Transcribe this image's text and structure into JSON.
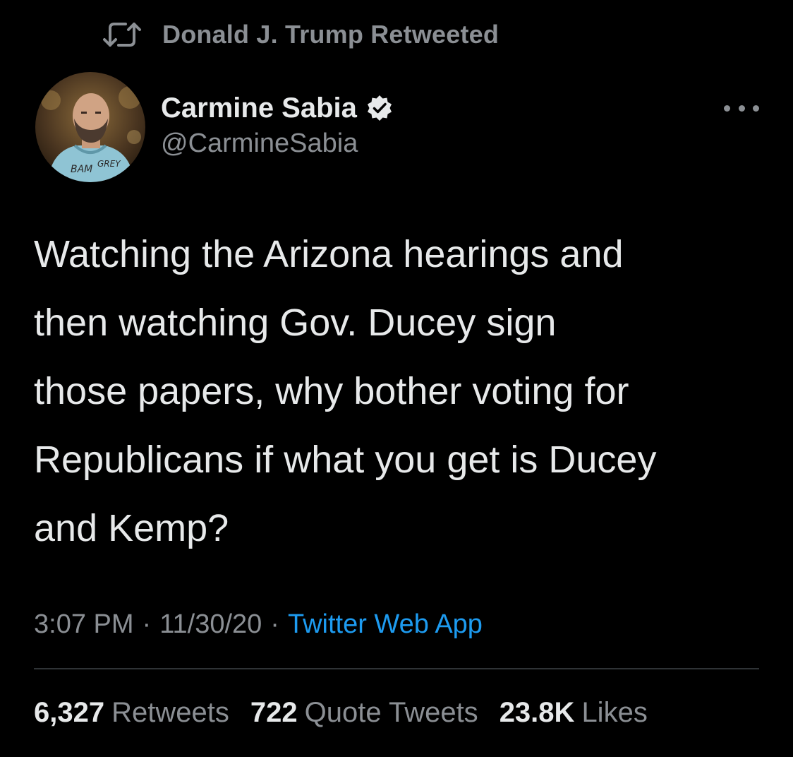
{
  "context": {
    "retweet_label": "Donald J. Trump Retweeted",
    "retweet_icon": "retweet-icon"
  },
  "author": {
    "name": "Carmine Sabia",
    "handle": "@CarmineSabia",
    "verified_icon": "verified-badge-icon",
    "avatar_icon": "avatar-image"
  },
  "tweet": {
    "text": "Watching the Arizona hearings and\nthen watching Gov. Ducey sign\nthose papers, why bother voting for\nRepublicans if what you get is Ducey\nand Kemp?"
  },
  "meta": {
    "time": "3:07 PM",
    "separator": "·",
    "date": "11/30/20",
    "source": "Twitter Web App"
  },
  "stats": {
    "retweets": {
      "count": "6,327",
      "label": "Retweets"
    },
    "quotes": {
      "count": "722",
      "label": "Quote Tweets"
    },
    "likes": {
      "count": "23.8K",
      "label": "Likes"
    }
  },
  "colors": {
    "background": "#000000",
    "primary_text": "#e7e9ea",
    "secondary_text": "#8b8f94",
    "link": "#1d9bf0",
    "divider": "#2f3336"
  },
  "icons": {
    "more": "more-options-icon"
  }
}
